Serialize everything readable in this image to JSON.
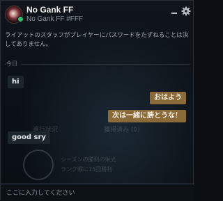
{
  "header": {
    "title": "No Gank FF",
    "subtitle": "No Gank FF #FFF"
  },
  "notice": "ライアットのスタッフがプレイヤーにパスワードをたずねることは決してありません。",
  "date_separator": "今日",
  "messages": [
    {
      "direction": "incoming",
      "text": "hi"
    },
    {
      "direction": "outgoing",
      "text": "おはよう"
    },
    {
      "direction": "outgoing",
      "text": "次は一緒に勝とうな！"
    },
    {
      "direction": "incoming",
      "text": "good sry"
    }
  ],
  "background_overlay": {
    "tab_progress": "進行状況",
    "tab_completed": "獲得済み (0)",
    "mission_title": "シーズンの勝利の栄光",
    "mission_desc": "ランク戦に15回勝利"
  },
  "input": {
    "placeholder": "ここに入力してください",
    "value": ""
  },
  "colors": {
    "outgoing_bubble": "#8a6a39",
    "incoming_bubble": "#1d252d",
    "online_status": "#2fc07a"
  },
  "icons": {
    "minimize": "minimize-icon",
    "settings": "gear-icon"
  }
}
